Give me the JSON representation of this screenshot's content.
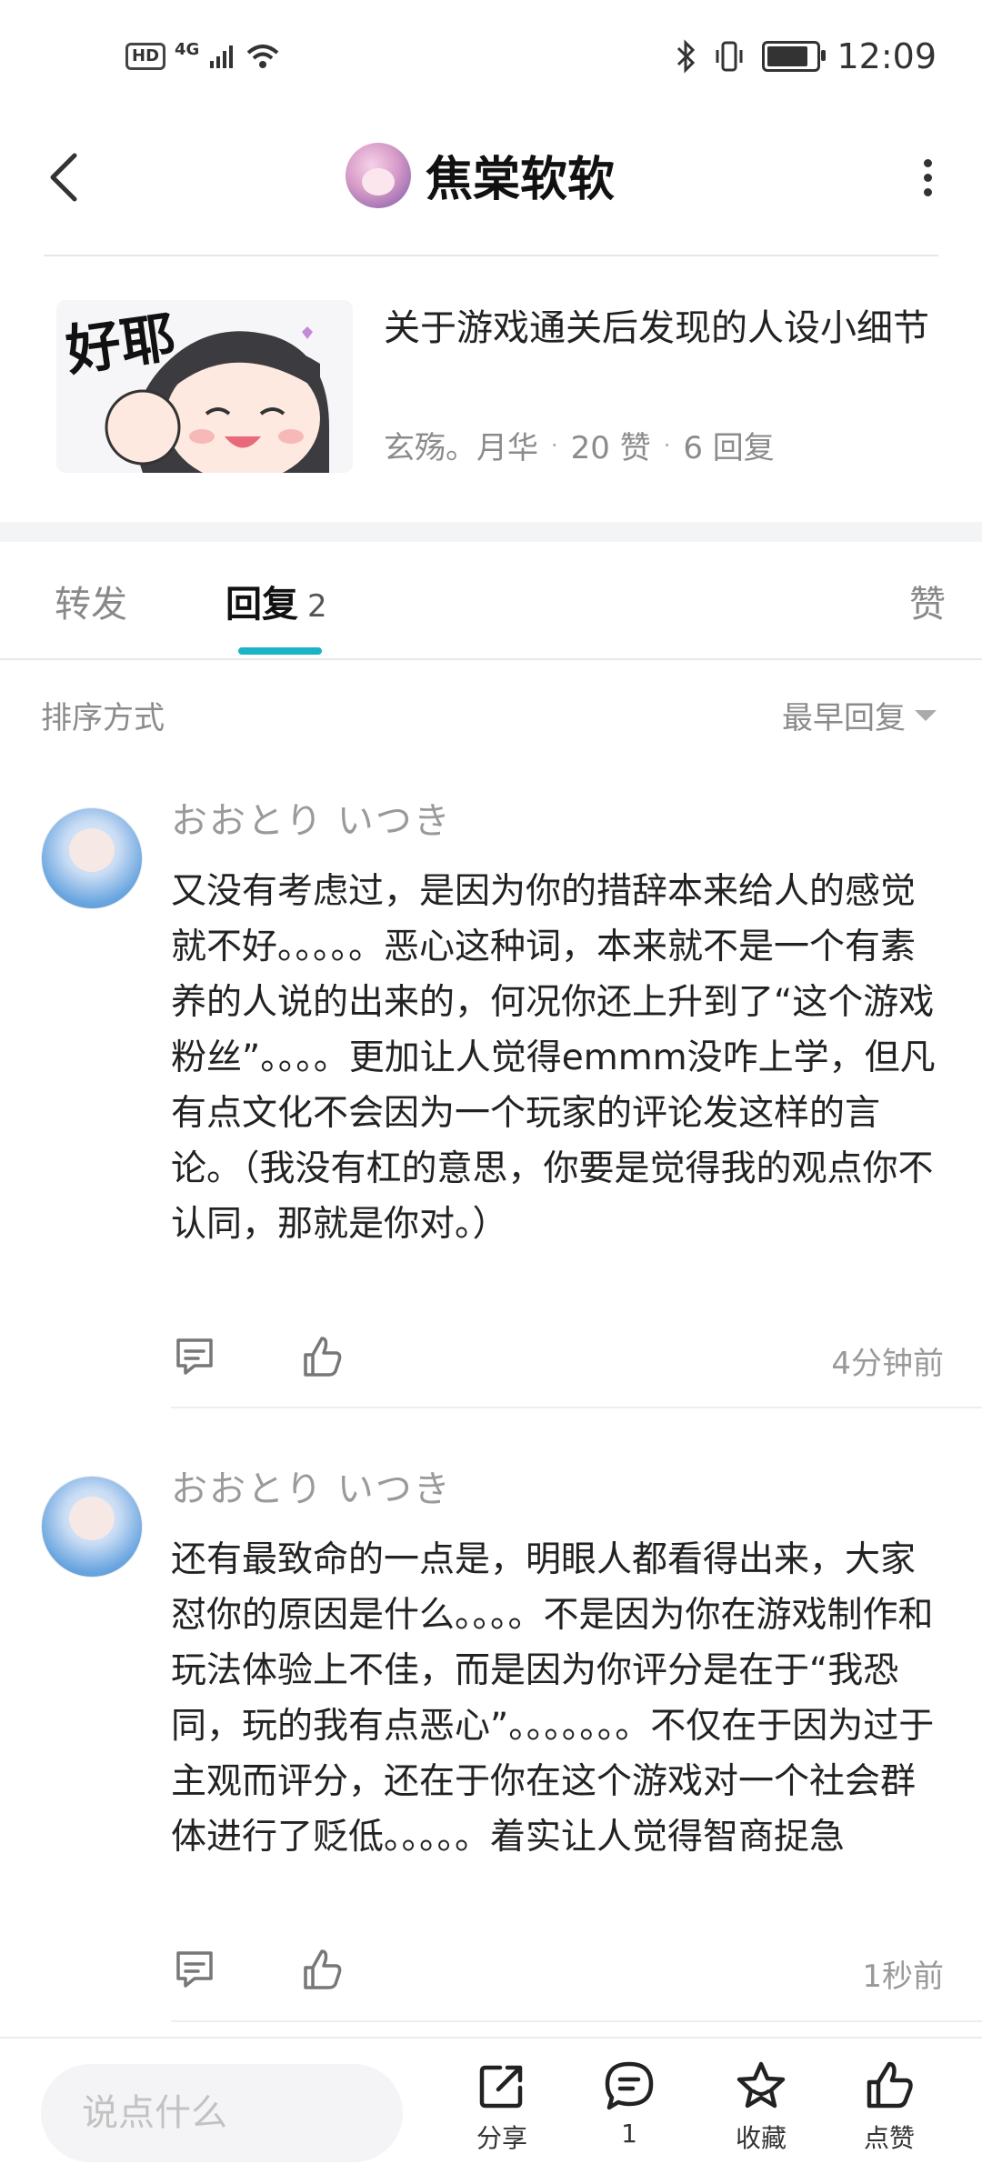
{
  "status_bar": {
    "left_badge": "HD",
    "network": "4G",
    "time": "12:09"
  },
  "header": {
    "title": "焦棠软软"
  },
  "post": {
    "thumb_text": "好耶",
    "title": "关于游戏通关后发现的人设小细节",
    "author": "玄殇。月华",
    "likes": "20 赞",
    "replies": "6 回复"
  },
  "tabs": {
    "forward": "转发",
    "replies": "回复",
    "replies_count": "2",
    "likes": "赞"
  },
  "sort": {
    "label": "排序方式",
    "selected": "最早回复"
  },
  "comments": [
    {
      "name": "おおとり いつき",
      "text": "又没有考虑过，是因为你的措辞本来给人的感觉就不好。。。。。恶心这种词，本来就不是一个有素养的人说的出来的，何况你还上升到了“这个游戏粉丝”。。。。更加让人觉得emmm没咋上学，但凡有点文化不会因为一个玩家的评论发这样的言论。（我没有杠的意思，你要是觉得我的观点你不认同，那就是你对。）",
      "time": "4分钟前"
    },
    {
      "name": "おおとり いつき",
      "text": "还有最致命的一点是，明眼人都看得出来，大家怼你的原因是什么。。。。不是因为你在游戏制作和玩法体验上不佳，而是因为你评分是在于“我恐同，玩的我有点恶心”。。。。。。。不仅在于因为过于主观而评分，还在于你在这个游戏对一个社会群体进行了贬低。。。。。着实让人觉得智商捉急",
      "time": "1秒前"
    }
  ],
  "bottom_bar": {
    "input_placeholder": "说点什么",
    "share": "分享",
    "comment_count": "1",
    "favorite": "收藏",
    "like": "点赞"
  },
  "colors": {
    "accent": "#1ab3c8",
    "muted_text": "#8b8b8b",
    "divider": "#eeeeee"
  }
}
